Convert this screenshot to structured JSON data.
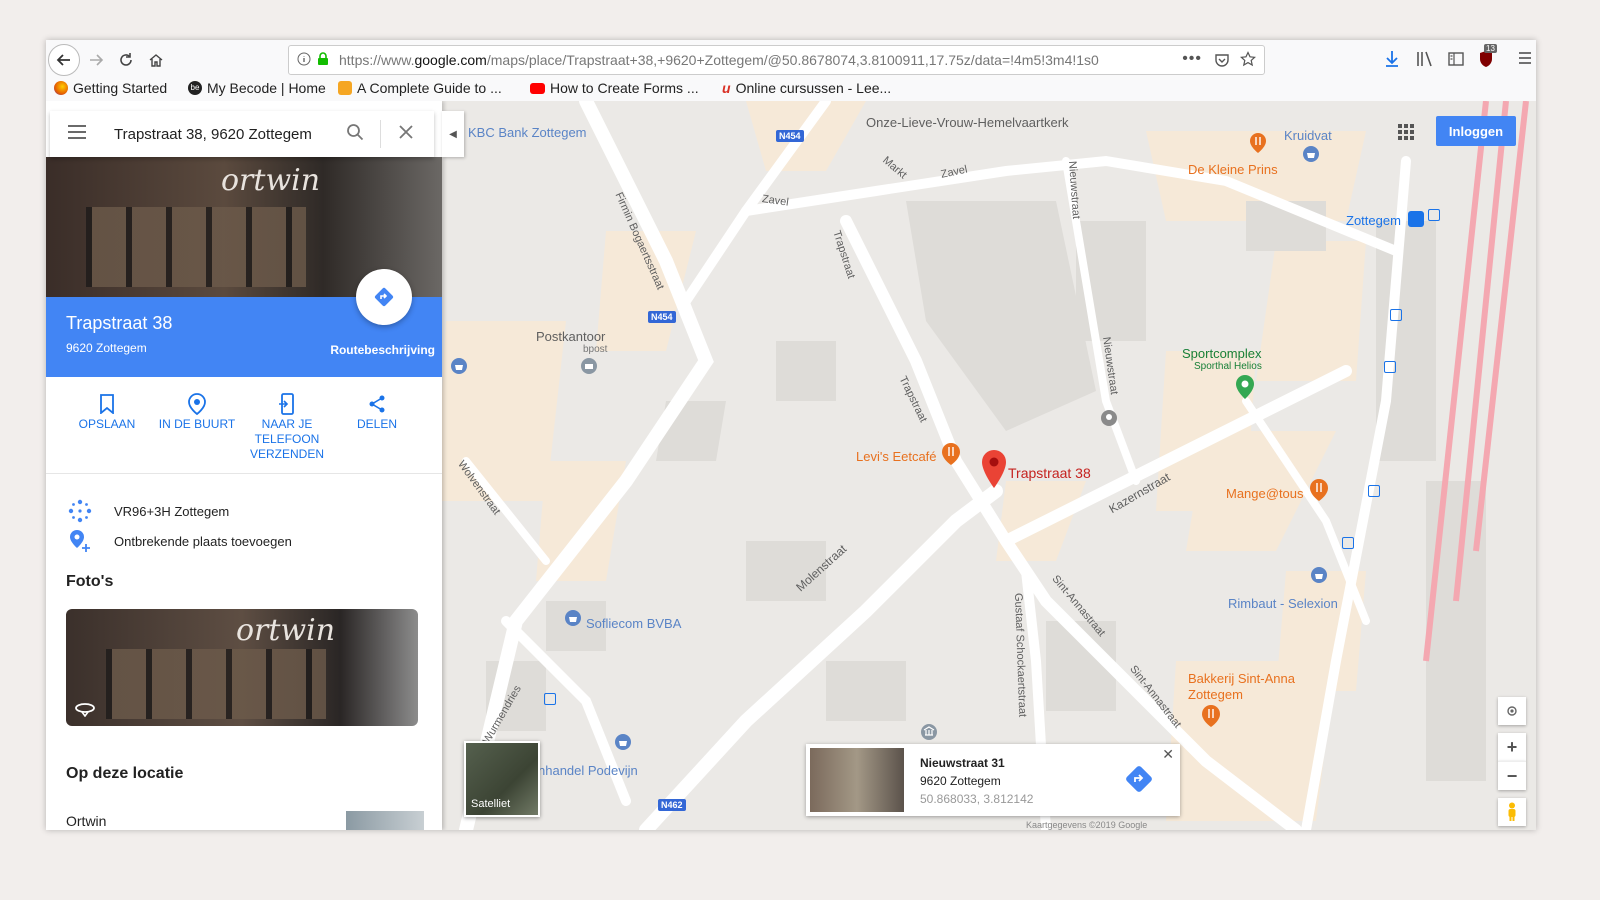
{
  "browser": {
    "url_prefix": "https://www.",
    "url_host": "google.com",
    "url_rest": "/maps/place/Trapstraat+38,+9620+Zottegem/@50.8678074,3.8100911,17.75z/data=!4m5!3m4!1s0",
    "ublock_count": "13",
    "bookmarks": [
      "Getting Started",
      "My Becode | Home",
      "A Complete Guide to ...",
      "How to Create Forms ...",
      "Online cursussen - Lee..."
    ]
  },
  "search": {
    "value": "Trapstraat 38, 9620 Zottegem"
  },
  "place": {
    "title": "Trapstraat 38",
    "subtitle": "9620 Zottegem",
    "route_label": "Routebeschrijving",
    "hero_sign": "ortwin"
  },
  "actions": [
    {
      "label": "OPSLAAN"
    },
    {
      "label": "IN DE BUURT"
    },
    {
      "label": "NAAR JE TELEFOON VERZENDEN"
    },
    {
      "label": "DELEN"
    }
  ],
  "details": {
    "plus_code": "VR96+3H Zottegem",
    "add_place": "Ontbrekende plaats toevoegen"
  },
  "photos": {
    "heading": "Foto's",
    "sign": "ortwin"
  },
  "at_location": {
    "heading": "Op deze locatie",
    "first_item": "Ortwin"
  },
  "map": {
    "login_label": "Inloggen",
    "satellite_label": "Satelliet",
    "pin_label": "Trapstraat 38",
    "pois": {
      "kbc": "KBC Bank Zottegem",
      "church": "Onze-Lieve-Vrouw-Hemelvaartkerk",
      "kruidvat": "Kruidvat",
      "kleine_prins": "De Kleine Prins",
      "zottegem": "Zottegem",
      "postkantoor": "Postkantoor",
      "bpost": "bpost",
      "sportcomplex": "Sportcomplex",
      "sporthal": "Sporthal Helios",
      "levis": "Levi's Eetcafé",
      "mange": "Mange@tous",
      "sofliecom": "Sofliecom BVBA",
      "rimbaut": "Rimbaut - Selexion",
      "bakkerij1": "Bakkerij Sint-Anna",
      "bakkerij2": "Zottegem",
      "podevijn": "nhandel Podevijn"
    },
    "streets": {
      "zavel1": "Zavel",
      "zavel2": "Zavel",
      "markt": "Markt",
      "firmin": "Firmin Bogaertsstraat",
      "trapstraat1": "Trapstraat",
      "trapstraat2": "Trapstraat",
      "nieuwstraat1": "Nieuwstraat",
      "nieuwstraat2": "Nieuwstraat",
      "kazernstraat": "Kazernstraat",
      "molenstraat": "Molenstraat",
      "wolvenstraat": "Wolvenstraat",
      "wurmendries": "Wurmendries",
      "gustaaf": "Gustaaf Schockaertstraat",
      "sintanna1": "Sint-Annastraat",
      "sintanna2": "Sint-Annastraat"
    },
    "road_shields": [
      "N454",
      "N454",
      "N462"
    ],
    "infocard": {
      "title": "Nieuwstraat 31",
      "subtitle": "9620 Zottegem",
      "coords": "50.868033, 3.812142"
    },
    "footer": "Kaartgegevens ©2019 Google"
  },
  "colors": {
    "accent_blue": "#4285f4",
    "action_blue": "#1a73e8",
    "poi_orange": "#e8711f",
    "poi_blue": "#1a73e8",
    "poi_green": "#188038",
    "pin_red": "#ea4335"
  }
}
